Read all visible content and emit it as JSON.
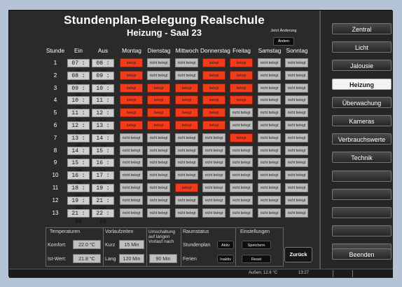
{
  "header": {
    "title": "Stundenplan-Belegung Realschule",
    "subtitle": "Heizung - Saal 23",
    "change_label": "Jetzt Änderung",
    "change_button": "Ändern"
  },
  "columns": {
    "stunde": "Stunde",
    "ein": "Ein",
    "aus": "Aus",
    "days": [
      "Montag",
      "Dienstag",
      "Mittwoch",
      "Donnerstag",
      "Freitag",
      "Samstag",
      "Sonntag"
    ]
  },
  "labels": {
    "busy": "belegt",
    "free": "nicht belegt"
  },
  "schedule": [
    {
      "n": "1",
      "ein": "07 : 45",
      "aus": "08 : 30",
      "d": [
        1,
        0,
        0,
        1,
        1,
        0,
        0
      ]
    },
    {
      "n": "2",
      "ein": "08 : 35",
      "aus": "09 : 20",
      "d": [
        1,
        0,
        0,
        1,
        1,
        0,
        0
      ]
    },
    {
      "n": "3",
      "ein": "09 : 35",
      "aus": "10 : 20",
      "d": [
        1,
        1,
        1,
        1,
        1,
        0,
        0
      ]
    },
    {
      "n": "4",
      "ein": "10 : 25",
      "aus": "11 : 10",
      "d": [
        1,
        1,
        1,
        1,
        1,
        0,
        0
      ]
    },
    {
      "n": "5",
      "ein": "11 : 25",
      "aus": "12 : 10",
      "d": [
        1,
        1,
        1,
        1,
        0,
        0,
        0
      ]
    },
    {
      "n": "6",
      "ein": "12 : 15",
      "aus": "13 : 00",
      "d": [
        1,
        1,
        1,
        1,
        0,
        0,
        0
      ]
    },
    {
      "n": "7",
      "ein": "13 : 45",
      "aus": "14 : 30",
      "d": [
        0,
        0,
        0,
        0,
        1,
        0,
        0
      ]
    },
    {
      "n": "8",
      "ein": "14 : 35",
      "aus": "15 : 15",
      "d": [
        0,
        0,
        0,
        0,
        0,
        0,
        0
      ]
    },
    {
      "n": "9",
      "ein": "15 : 30",
      "aus": "16 : 15",
      "d": [
        0,
        0,
        0,
        0,
        0,
        0,
        0
      ]
    },
    {
      "n": "10",
      "ein": "16 : 20",
      "aus": "17 : 00",
      "d": [
        0,
        0,
        0,
        0,
        0,
        0,
        0
      ]
    },
    {
      "n": "11",
      "ein": "18 : 00",
      "aus": "19 : 30",
      "d": [
        0,
        0,
        1,
        0,
        0,
        0,
        0
      ]
    },
    {
      "n": "12",
      "ein": "19 : 30",
      "aus": "21 : 00",
      "d": [
        0,
        0,
        0,
        0,
        0,
        0,
        0
      ]
    },
    {
      "n": "13",
      "ein": "21 : 00",
      "aus": "22 : 00",
      "d": [
        0,
        0,
        0,
        0,
        0,
        0,
        0
      ]
    }
  ],
  "bottom": {
    "temps_title": "Temperaturen",
    "komfort_label": "Komfort:",
    "komfort_value": "22.0 °C",
    "ist_label": "Ist-Wert:",
    "ist_value": "21.8 °C",
    "vorlauf_title": "Vorlaufzeiten",
    "kurz_label": "Kurz",
    "kurz_value": "15 Min",
    "lang_label": "Lang",
    "lang_value": "120 Min",
    "umschalt_title": "Umschaltung auf langen Vorlauf nach",
    "umschalt_value": "90 Min",
    "raum_title": "Raumstatus",
    "stundenplan_label": "Stundenplan",
    "ferien_label": "Ferien",
    "aktiv_button": "Aktiv",
    "inaktiv_button": "Inaktiv",
    "einst_title": "Einstellungen",
    "speichern_button": "Speichern",
    "reset_button": "Reset",
    "back_button": "Zurück"
  },
  "nav": {
    "items": [
      "Zentral",
      "Licht",
      "Jalousie",
      "Heizung",
      "Überwachung",
      "Kameras",
      "Verbrauchswerte",
      "Technik",
      "",
      "",
      "",
      "",
      ""
    ],
    "active": "Heizung",
    "exit_button": "Beenden"
  },
  "status": {
    "outside": "Außen: 12.6 °C",
    "time": "13:27"
  },
  "colors": {
    "busy": "#f13c1c",
    "free": "#bdbdbd"
  }
}
